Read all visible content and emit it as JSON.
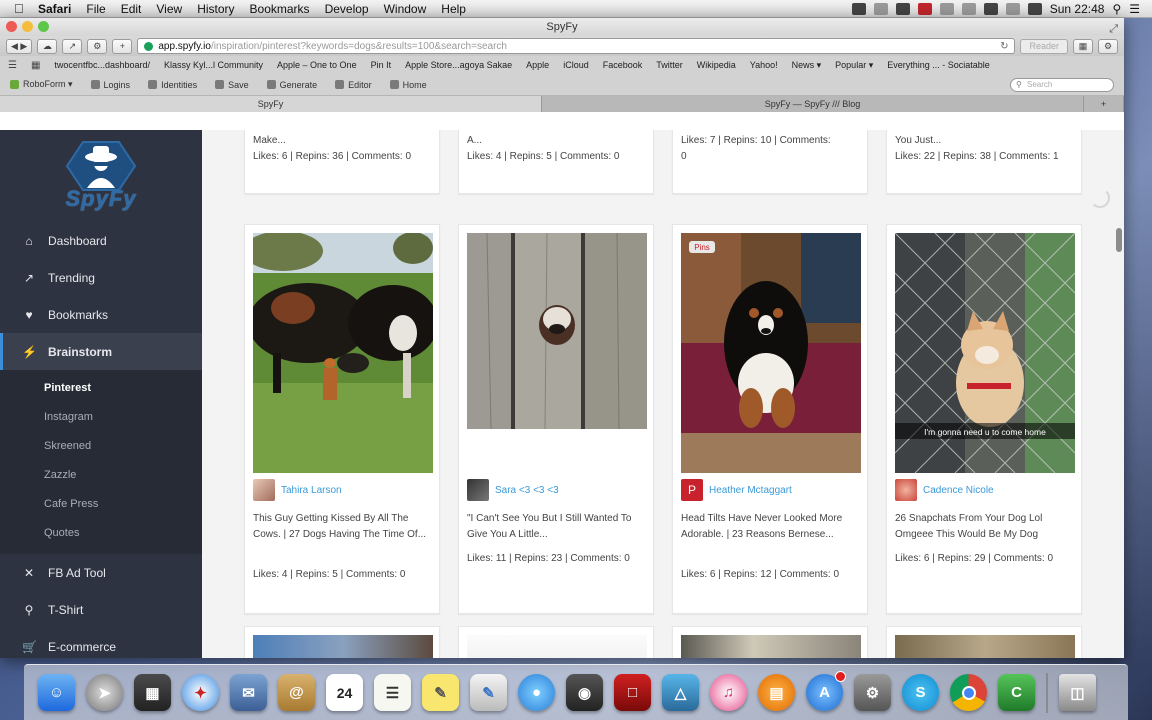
{
  "menubar": {
    "items": [
      "Safari",
      "File",
      "Edit",
      "View",
      "History",
      "Bookmarks",
      "Develop",
      "Window",
      "Help"
    ],
    "clock": "Sun 22:48"
  },
  "window": {
    "title": "SpyFy",
    "url_host": "app.spyfy.io",
    "url_path": "/inspiration/pinterest?keywords=dogs&results=100&search=search",
    "reader_label": "Reader"
  },
  "bookmarks": [
    "twocentfbc...dashboard/",
    "Klassy Kyl...l Community",
    "Apple – One to One",
    "Pin It",
    "Apple Store...agoya Sakae",
    "Apple",
    "iCloud",
    "Facebook",
    "Twitter",
    "Wikipedia",
    "Yahoo!",
    "News ▾",
    "Popular ▾",
    "Everything ... - Sociatable"
  ],
  "extensions": {
    "items": [
      "RoboForm ▾",
      "Logins",
      "Identities",
      "Save",
      "Generate",
      "Editor",
      "Home"
    ],
    "search_placeholder": "Search"
  },
  "tabs": [
    "SpyFy",
    "SpyFy — SpyFy /// Blog"
  ],
  "sidebar": {
    "logo_text": "SpyFy",
    "nav": [
      {
        "label": "Dashboard",
        "icon": "home-icon"
      },
      {
        "label": "Trending",
        "icon": "trend-icon"
      },
      {
        "label": "Bookmarks",
        "icon": "heart-icon"
      },
      {
        "label": "Brainstorm",
        "icon": "bolt-icon"
      }
    ],
    "subnav": [
      "Pinterest",
      "Instagram",
      "Skreened",
      "Zazzle",
      "Cafe Press",
      "Quotes"
    ],
    "nav_bottom": [
      {
        "label": "FB Ad Tool",
        "icon": "tools-icon"
      },
      {
        "label": "T-Shirt",
        "icon": "search-icon"
      },
      {
        "label": "E-commerce",
        "icon": "cart-icon"
      }
    ]
  },
  "top_cards": [
    {
      "desc": "Make...",
      "stats": "Likes: 6 | Repins: 36 | Comments: 0"
    },
    {
      "desc": "A...",
      "stats": "Likes: 4 | Repins: 5 | Comments: 0"
    },
    {
      "desc": "",
      "stats": "Likes: 7 | Repins: 10 | Comments: 0"
    },
    {
      "desc": "You Just...",
      "stats": "Likes: 22 | Repins: 38 | Comments: 1"
    }
  ],
  "cards": [
    {
      "user": "Tahira Larson",
      "desc": "This Guy Getting Kissed By All The Cows. | 27 Dogs Having The Time Of...",
      "stats": "Likes: 4 | Repins: 5 | Comments: 0"
    },
    {
      "user": "Sara <3 <3 <3",
      "desc": "\"I Can't See You But I Still Wanted To Give You A Little...",
      "stats": "Likes: 11 | Repins: 23 | Comments: 0"
    },
    {
      "user": "Heather Mctaggart",
      "desc": "Head Tilts Have Never Looked More Adorable. | 23 Reasons Bernese...",
      "stats": "Likes: 6 | Repins: 12 | Comments: 0",
      "tag": "Pins"
    },
    {
      "user": "Cadence Nicole",
      "desc": "26 Snapchats From Your Dog Lol Omgeee This Would Be My Dog",
      "stats": "Likes: 6 | Repins: 29 | Comments: 0",
      "caption": "I'm gonna need u to come home"
    }
  ],
  "dock": {
    "calendar_day": "24"
  },
  "colors": {
    "sidebar": "#2d3340",
    "accent": "#3b8fd9",
    "link": "#3a9ad9"
  }
}
